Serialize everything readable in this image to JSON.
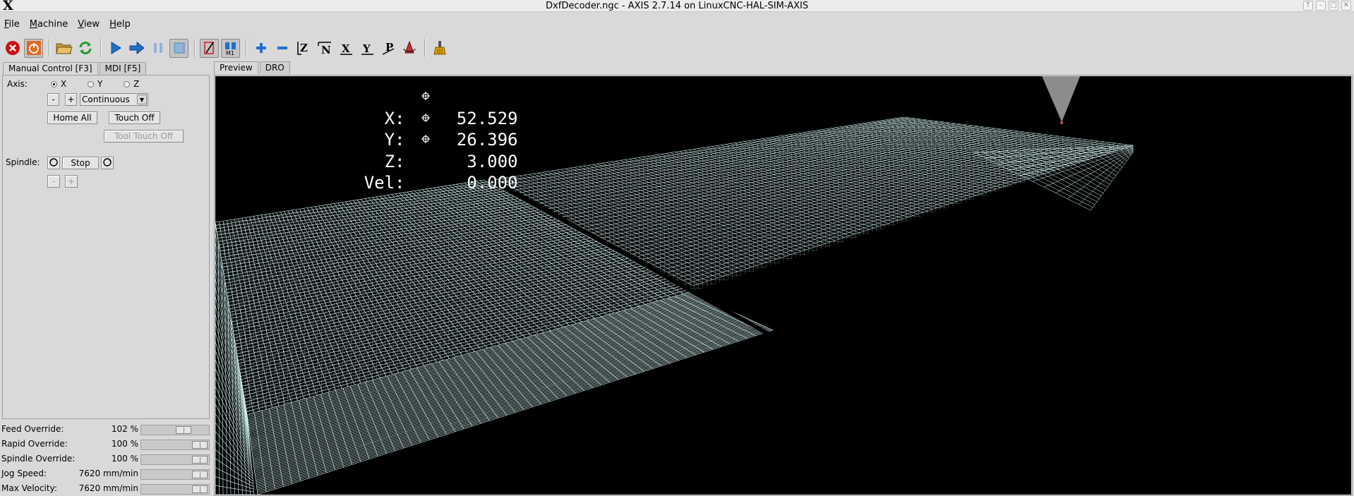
{
  "window": {
    "title": "DxfDecoder.ngc - AXIS 2.7.14 on LinuxCNC-HAL-SIM-AXIS",
    "logo": "X",
    "controls": [
      "up-icon",
      "minimize-icon",
      "maximize-icon",
      "close-icon"
    ]
  },
  "menu": [
    {
      "label": "File",
      "mnemonic": "F",
      "rest": "ile"
    },
    {
      "label": "Machine",
      "mnemonic": "M",
      "rest": "achine"
    },
    {
      "label": "View",
      "mnemonic": "V",
      "rest": "iew"
    },
    {
      "label": "Help",
      "mnemonic": "H",
      "rest": "elp"
    }
  ],
  "toolbar": {
    "buttons": [
      "estop-icon",
      "machine-power-icon",
      "open-file-icon",
      "reload-icon",
      "run-icon",
      "step-icon",
      "pause-icon",
      "stop-icon",
      "block-delete-icon",
      "optional-stop-icon",
      "zoom-in-icon",
      "zoom-out-icon",
      "view-z-icon",
      "view-z2-icon",
      "view-x-icon",
      "view-y-icon",
      "view-p-icon",
      "rotate-icon",
      "clear-plot-icon"
    ],
    "colors": {
      "estop": "#cc1111",
      "run": "#1f6fd0",
      "reload": "#2a9a2a",
      "tool": "#e0a000"
    }
  },
  "left_tabs": [
    "Manual Control [F3]",
    "MDI [F5]"
  ],
  "manual": {
    "axis_label": "Axis:",
    "axes": [
      "X",
      "Y",
      "Z"
    ],
    "selected_axis": "X",
    "jog_minus": "-",
    "jog_plus": "+",
    "jog_mode": "Continuous",
    "home_all": "Home All",
    "touch_off": "Touch Off",
    "tool_touch_off": "Tool Touch Off",
    "spindle_label": "Spindle:",
    "spindle_stop": "Stop",
    "spindle_minus": "-",
    "spindle_plus": "+"
  },
  "overrides": [
    {
      "name": "Feed Override:",
      "value": "102 %",
      "level": 0.68
    },
    {
      "name": "Rapid Override:",
      "value": "100 %",
      "level": 1.0
    },
    {
      "name": "Spindle Override:",
      "value": "100 %",
      "level": 1.0
    },
    {
      "name": "Jog Speed:",
      "value": "7620 mm/min",
      "level": 1.0
    },
    {
      "name": "Max Velocity:",
      "value": "7620 mm/min",
      "level": 1.0
    }
  ],
  "right_tabs": [
    "Preview",
    "DRO"
  ],
  "dro": [
    {
      "axis": "X:",
      "value": "52.529",
      "homed": true
    },
    {
      "axis": "Y:",
      "value": "26.396",
      "homed": true
    },
    {
      "axis": "Z:",
      "value": "3.000",
      "homed": true
    },
    {
      "axis": "Vel:",
      "value": "0.000",
      "homed": false
    }
  ]
}
